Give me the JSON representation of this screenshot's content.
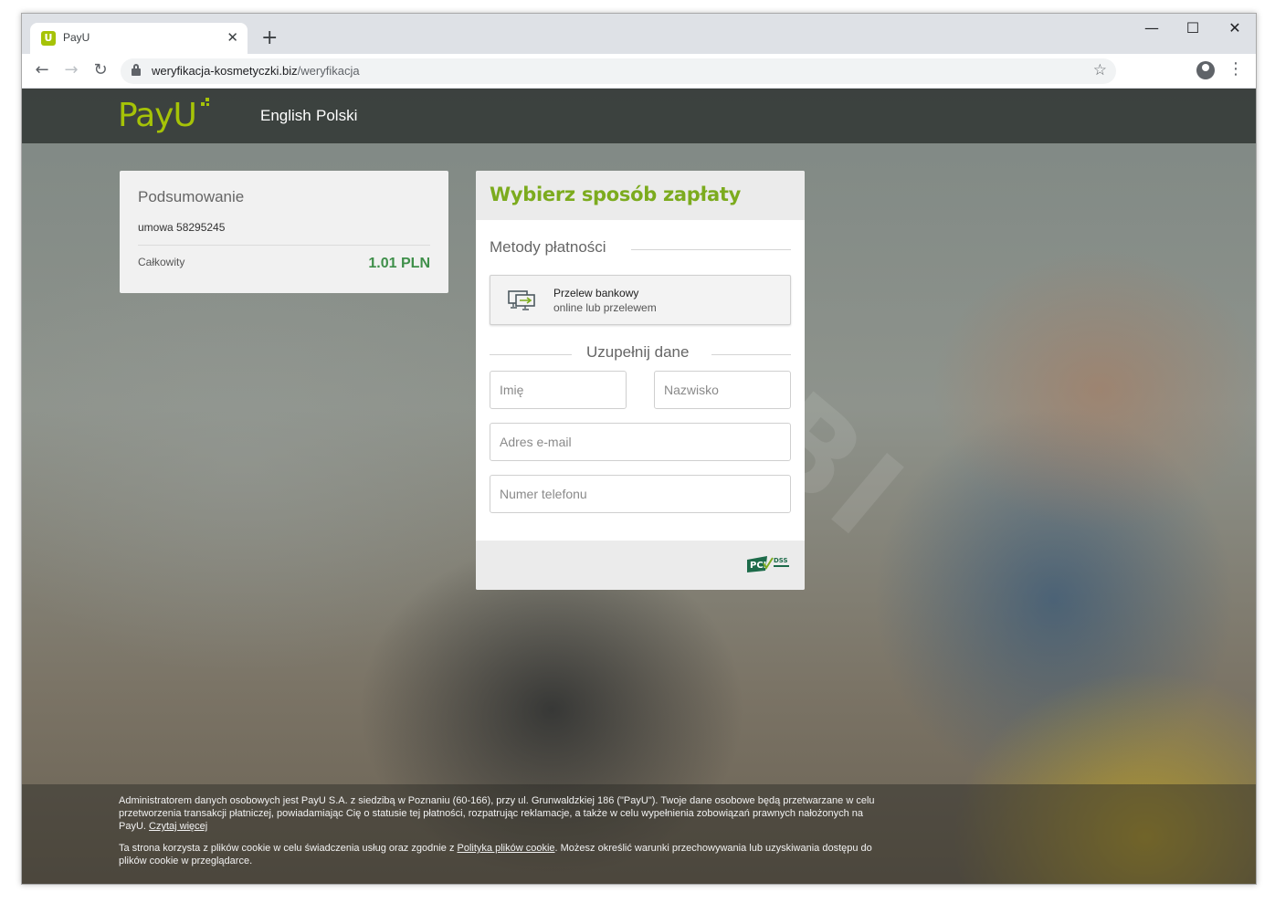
{
  "browser": {
    "tab_title": "PayU",
    "favicon_letter": "U",
    "tab_close": "✕",
    "new_tab": "+",
    "window_controls": {
      "minimize": "—",
      "maximize": "☐",
      "close": "✕"
    },
    "nav": {
      "back": "←",
      "forward": "→",
      "reload": "↻"
    },
    "url_host": "weryfikacja-kosmetyczki.biz",
    "url_path": "/weryfikacja",
    "bookmark_star": "☆",
    "menu": "⋮"
  },
  "header": {
    "logo_text": "PayU",
    "languages": [
      "English",
      "Polski"
    ]
  },
  "watermark": "PREBI",
  "summary": {
    "title": "Podsumowanie",
    "contract": "umowa 58295245",
    "total_label": "Całkowity",
    "total_value": "1.01 PLN"
  },
  "payment": {
    "title": "Wybierz sposób zapłaty",
    "methods_label": "Metody płatności",
    "method": {
      "title": "Przelew bankowy",
      "subtitle": "online lub przelewem"
    },
    "fill_label": "Uzupełnij dane",
    "fields": {
      "first_name": "Imię",
      "last_name": "Nazwisko",
      "email": "Adres e-mail",
      "phone": "Numer telefonu"
    },
    "badge": "PCI DSS"
  },
  "legal": {
    "privacy_text": "Administratorem danych osobowych jest PayU S.A. z siedzibą w Poznaniu (60-166), przy ul. Grunwaldzkiej 186 (\"PayU\"). Twoje dane osobowe będą przetwarzane w celu przetworzenia transakcji płatniczej, powiadamiając Cię o statusie tej płatności, rozpatrując reklamacje, a także w celu wypełnienia zobowiązań prawnych nałożonych na PayU.",
    "privacy_link": "Czytaj więcej",
    "cookie_text_before": "Ta strona korzysta z plików cookie w celu świadczenia usług oraz zgodnie z",
    "cookie_link": "Polityka plików cookie",
    "cookie_text_after": ". Możesz określić warunki przechowywania lub uzyskiwania dostępu do plików cookie w przeglądarce."
  },
  "colors": {
    "brand_green": "#a6c307",
    "title_green": "#7cab1e",
    "amount_green": "#3f8f4a"
  }
}
